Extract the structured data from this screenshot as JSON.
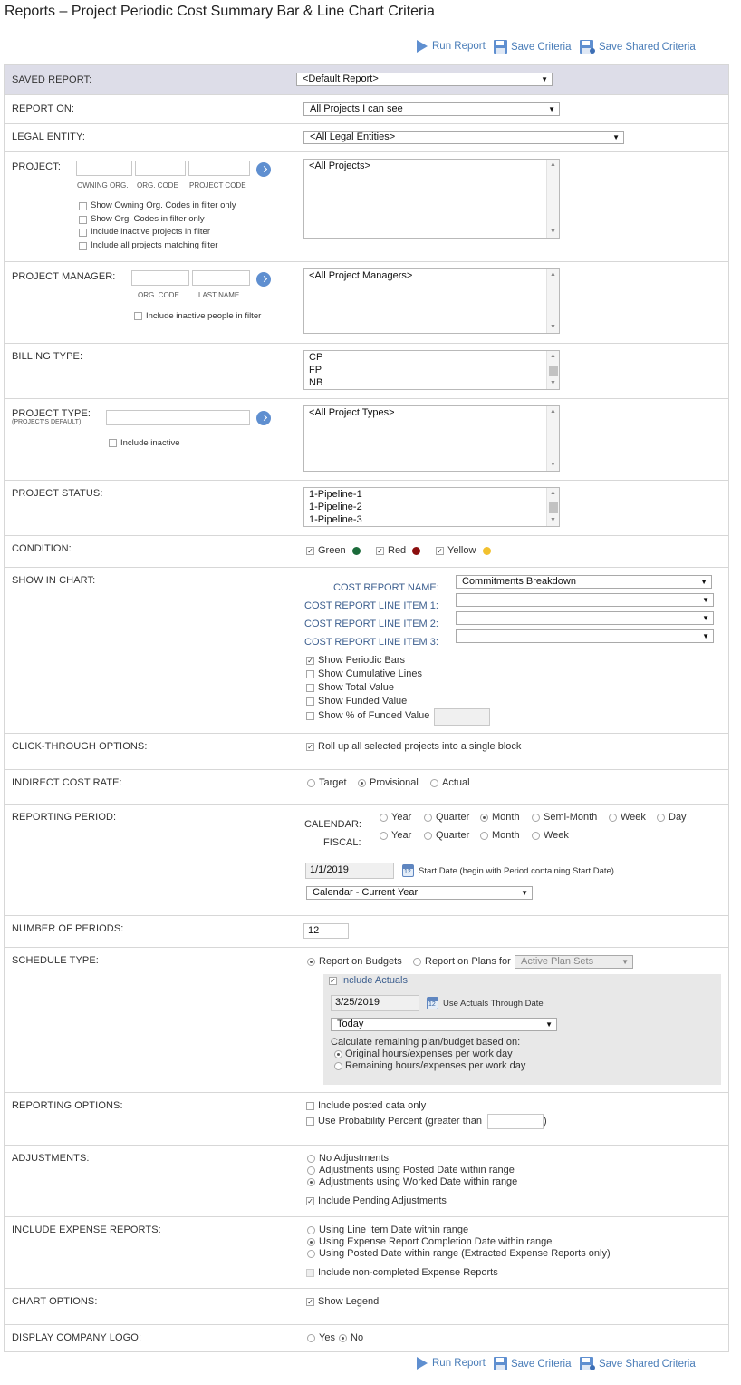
{
  "page": {
    "title": "Reports – Project Periodic Cost Summary Bar & Line Chart Criteria"
  },
  "toolbar": {
    "run": "Run Report",
    "save": "Save Criteria",
    "save_shared": "Save Shared Criteria"
  },
  "saved_report": {
    "label": "SAVED REPORT:",
    "value": "<Default Report>"
  },
  "report_on": {
    "label": "REPORT ON:",
    "value": "All Projects I can see"
  },
  "legal_entity": {
    "label": "LEGAL ENTITY:",
    "value": "<All Legal Entities>"
  },
  "project": {
    "label": "PROJECT:",
    "sub_labels": [
      "OWNING ORG.",
      "ORG. CODE",
      "PROJECT CODE"
    ],
    "options": [
      "Show Owning Org. Codes in filter only",
      "Show Org. Codes in filter only",
      "Include inactive projects in filter",
      "Include all projects matching filter"
    ],
    "list": [
      "<All Projects>"
    ]
  },
  "project_manager": {
    "label": "PROJECT MANAGER:",
    "sub_labels": [
      "ORG. CODE",
      "LAST NAME"
    ],
    "option": "Include inactive people in filter",
    "list": [
      "<All Project Managers>"
    ]
  },
  "billing_type": {
    "label": "BILLING TYPE:",
    "list": [
      "CP",
      "FP",
      "NB"
    ]
  },
  "project_type": {
    "label": "PROJECT TYPE:",
    "sub_label": "(PROJECT'S DEFAULT)",
    "option": "Include inactive",
    "list": [
      "<All Project Types>"
    ]
  },
  "project_status": {
    "label": "PROJECT STATUS:",
    "list": [
      "1-Pipeline-1",
      "1-Pipeline-2",
      "1-Pipeline-3"
    ]
  },
  "condition": {
    "label": "CONDITION:",
    "items": [
      {
        "label": "Green",
        "color": "#1b6b3a"
      },
      {
        "label": "Red",
        "color": "#8b0e0e"
      },
      {
        "label": "Yellow",
        "color": "#f2c12e"
      }
    ]
  },
  "show_in_chart": {
    "label": "SHOW IN CHART:",
    "cost_report_name_label": "COST REPORT NAME:",
    "cost_report_name_value": "Commitments Breakdown",
    "line_item_1_label": "COST REPORT LINE ITEM 1:",
    "line_item_2_label": "COST REPORT LINE ITEM 2:",
    "line_item_3_label": "COST REPORT LINE ITEM 3:",
    "options": [
      "Show Periodic Bars",
      "Show Cumulative Lines",
      "Show Total Value",
      "Show Funded Value",
      "Show % of Funded Value"
    ]
  },
  "click_through": {
    "label": "CLICK-THROUGH OPTIONS:",
    "option": "Roll up all selected projects into a single block"
  },
  "indirect_cost": {
    "label": "INDIRECT COST RATE:",
    "options": [
      "Target",
      "Provisional",
      "Actual"
    ]
  },
  "reporting_period": {
    "label": "REPORTING PERIOD:",
    "calendar_label": "CALENDAR:",
    "fiscal_label": "FISCAL:",
    "calendar_options": [
      "Year",
      "Quarter",
      "Month",
      "Semi-Month",
      "Week",
      "Day"
    ],
    "fiscal_options": [
      "Year",
      "Quarter",
      "Month",
      "Week"
    ],
    "start_date": "1/1/2019",
    "start_date_note": "Start Date (begin with Period containing Start Date)",
    "range": "Calendar - Current Year"
  },
  "number_of_periods": {
    "label": "NUMBER OF PERIODS:",
    "value": "12"
  },
  "schedule_type": {
    "label": "SCHEDULE TYPE:",
    "budgets": "Report on Budgets",
    "plans": "Report on Plans for",
    "plan_sets": "Active Plan Sets",
    "include_actuals": "Include Actuals",
    "actuals_date": "3/25/2019",
    "actuals_note": "Use Actuals Through Date",
    "actuals_range": "Today",
    "calc_label": "Calculate remaining plan/budget based on:",
    "calc_options": [
      "Original hours/expenses per work day",
      "Remaining hours/expenses per work day"
    ]
  },
  "reporting_options": {
    "label": "REPORTING OPTIONS:",
    "posted_only": "Include posted data only",
    "probability": "Use Probability Percent (greater than",
    "close_paren": ")"
  },
  "adjustments": {
    "label": "ADJUSTMENTS:",
    "options": [
      "No Adjustments",
      "Adjustments using Posted Date within range",
      "Adjustments using Worked Date within range"
    ],
    "pending": "Include Pending Adjustments"
  },
  "expense_reports": {
    "label": "INCLUDE EXPENSE REPORTS:",
    "options": [
      "Using Line Item Date within range",
      "Using Expense Report Completion Date within range",
      "Using Posted Date within range (Extracted Expense Reports only)"
    ],
    "non_completed": "Include non-completed Expense Reports"
  },
  "chart_options": {
    "label": "CHART OPTIONS:",
    "show_legend": "Show Legend"
  },
  "company_logo": {
    "label": "DISPLAY COMPANY LOGO:",
    "options": [
      "Yes",
      "No"
    ]
  }
}
